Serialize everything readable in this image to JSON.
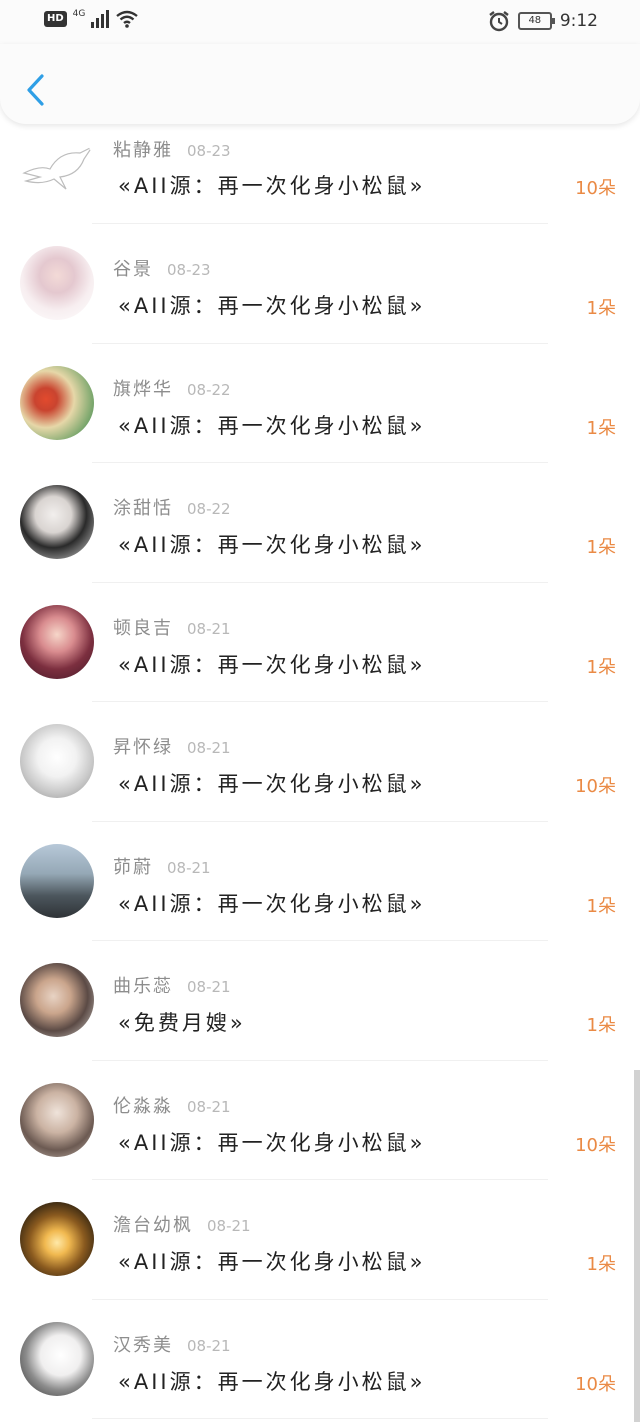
{
  "status_bar": {
    "hd": "HD",
    "network": "4G",
    "battery": "48",
    "time": "9:12"
  },
  "rows": [
    {
      "name": "粘静雅",
      "date": "08-23",
      "title": "«AII源：再一次化身小松鼠»",
      "count": "10朵"
    },
    {
      "name": "谷景",
      "date": "08-23",
      "title": "«AII源：再一次化身小松鼠»",
      "count": "1朵"
    },
    {
      "name": "旗烨华",
      "date": "08-22",
      "title": "«AII源：再一次化身小松鼠»",
      "count": "1朵"
    },
    {
      "name": "涂甜恬",
      "date": "08-22",
      "title": "«AII源：再一次化身小松鼠»",
      "count": "1朵"
    },
    {
      "name": "顿良吉",
      "date": "08-21",
      "title": "«AII源：再一次化身小松鼠»",
      "count": "1朵"
    },
    {
      "name": "昇怀绿",
      "date": "08-21",
      "title": "«AII源：再一次化身小松鼠»",
      "count": "10朵"
    },
    {
      "name": "茆蔚",
      "date": "08-21",
      "title": "«AII源：再一次化身小松鼠»",
      "count": "1朵"
    },
    {
      "name": "曲乐蕊",
      "date": "08-21",
      "title": "«免费月嫂»",
      "count": "1朵"
    },
    {
      "name": "伦淼淼",
      "date": "08-21",
      "title": "«AII源：再一次化身小松鼠»",
      "count": "10朵"
    },
    {
      "name": "澹台幼枫",
      "date": "08-21",
      "title": "«AII源：再一次化身小松鼠»",
      "count": "1朵"
    },
    {
      "name": "汉秀美",
      "date": "08-21",
      "title": "«AII源：再一次化身小松鼠»",
      "count": "10朵"
    }
  ],
  "colors": {
    "accent": "#2f9fe6",
    "count": "#ea8a45"
  }
}
